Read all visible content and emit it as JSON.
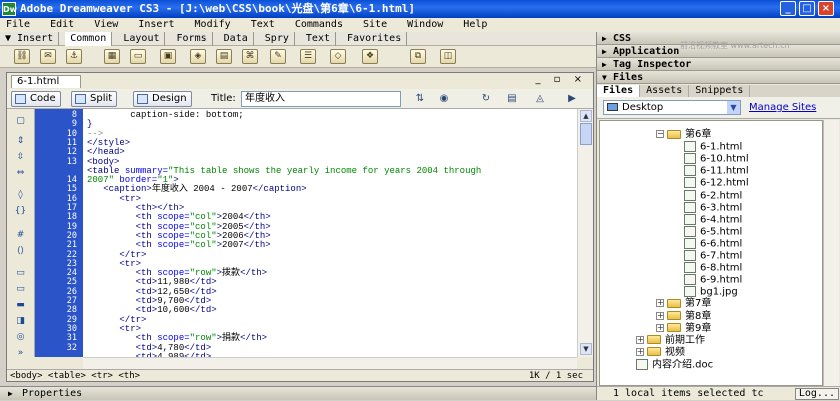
{
  "window": {
    "app_icon": "Dw",
    "title": "Adobe Dreamweaver CS3 - [J:\\web\\CSS\\book\\光盘\\第6章\\6-1.html]",
    "buttons": [
      "_",
      "□",
      "×"
    ]
  },
  "menu": [
    "File",
    "Edit",
    "View",
    "Insert",
    "Modify",
    "Text",
    "Commands",
    "Site",
    "Window",
    "Help"
  ],
  "insert_bar": {
    "label": "▼ Insert",
    "tabs": [
      "Common",
      "Layout",
      "Forms",
      "Data",
      "Spry",
      "Text",
      "Favorites"
    ],
    "active_tab": "Common"
  },
  "right_panel": {
    "watermark": "前沿视频教室 www.artech.cn",
    "panels": [
      "CSS",
      "Application",
      "Tag Inspector",
      "Files"
    ],
    "files_tabs": [
      "Files",
      "Assets",
      "Snippets"
    ],
    "site_select": "Desktop",
    "manage_sites": "Manage Sites",
    "tree": [
      {
        "label": "第6章",
        "type": "folder",
        "level": 0,
        "toggle": "−"
      },
      {
        "label": "6-1.html",
        "type": "file",
        "level": 1
      },
      {
        "label": "6-10.html",
        "type": "file",
        "level": 1
      },
      {
        "label": "6-11.html",
        "type": "file",
        "level": 1
      },
      {
        "label": "6-12.html",
        "type": "file",
        "level": 1
      },
      {
        "label": "6-2.html",
        "type": "file",
        "level": 1
      },
      {
        "label": "6-3.html",
        "type": "file",
        "level": 1
      },
      {
        "label": "6-4.html",
        "type": "file",
        "level": 1
      },
      {
        "label": "6-5.html",
        "type": "file",
        "level": 1
      },
      {
        "label": "6-6.html",
        "type": "file",
        "level": 1
      },
      {
        "label": "6-7.html",
        "type": "file",
        "level": 1
      },
      {
        "label": "6-8.html",
        "type": "file",
        "level": 1
      },
      {
        "label": "6-9.html",
        "type": "file",
        "level": 1
      },
      {
        "label": "bg1.jpg",
        "type": "file",
        "level": 1
      },
      {
        "label": "第7章",
        "type": "folder",
        "level": 0,
        "toggle": "+"
      },
      {
        "label": "第8章",
        "type": "folder",
        "level": 0,
        "toggle": "+"
      },
      {
        "label": "第9章",
        "type": "folder",
        "level": 0,
        "toggle": "+"
      },
      {
        "label": "前期工作",
        "type": "folder",
        "level": -1,
        "toggle": "+"
      },
      {
        "label": "视频",
        "type": "folder",
        "level": -1,
        "toggle": "+"
      },
      {
        "label": "内容介绍.doc",
        "type": "file",
        "level": -1
      }
    ],
    "status": "1 local items selected tc",
    "log_button": "Log..."
  },
  "document": {
    "tab": "6-1.html",
    "window_controls": "_ ▫ ×",
    "view_buttons": [
      "Code",
      "Split",
      "Design"
    ],
    "title_label": "Title:",
    "title_value": "年度收入",
    "line_numbers": [
      "8",
      "9",
      "10",
      "11",
      "12",
      "13",
      "",
      "14",
      "15",
      "16",
      "17",
      "18",
      "19",
      "20",
      "21",
      "22",
      "23",
      "24",
      "25",
      "26",
      "27",
      "28",
      "29",
      "30",
      "31",
      "32"
    ],
    "tag_selector": "<body> <table> <tr> <th>",
    "size": "1K / 1 sec"
  },
  "code_lines": [
    [
      [
        "tx",
        "        caption-side: bottom;"
      ]
    ],
    [
      [
        "tg",
        "}"
      ]
    ],
    [
      [
        "cm",
        "-->"
      ]
    ],
    [
      [
        "tg",
        "</style>"
      ]
    ],
    [
      [
        "tg",
        "</head>"
      ]
    ],
    [
      [
        "tg",
        "<body>"
      ]
    ],
    [
      [
        "tg",
        "<table "
      ],
      [
        "at",
        "summary="
      ],
      [
        "vl",
        "\"This table shows the yearly income for years 2004 through"
      ]
    ],
    [
      [
        "vl",
        "2007\" "
      ],
      [
        "at",
        "border="
      ],
      [
        "vl",
        "\"1\""
      ],
      [
        "tg",
        ">"
      ]
    ],
    [
      [
        "tg",
        "   <caption>"
      ],
      [
        "tx",
        "年度收入 2004 - 2007"
      ],
      [
        "tg",
        "</caption>"
      ]
    ],
    [
      [
        "tg",
        "      <tr>"
      ]
    ],
    [
      [
        "tg",
        "         <th></th>"
      ]
    ],
    [
      [
        "tg",
        "         <th "
      ],
      [
        "at",
        "scope="
      ],
      [
        "vl",
        "\"col\""
      ],
      [
        "tg",
        ">"
      ],
      [
        "tx",
        "2004"
      ],
      [
        "tg",
        "</th>"
      ]
    ],
    [
      [
        "tg",
        "         <th "
      ],
      [
        "at",
        "scope="
      ],
      [
        "vl",
        "\"col\""
      ],
      [
        "tg",
        ">"
      ],
      [
        "tx",
        "2005"
      ],
      [
        "tg",
        "</th>"
      ]
    ],
    [
      [
        "tg",
        "         <th "
      ],
      [
        "at",
        "scope="
      ],
      [
        "vl",
        "\"col\""
      ],
      [
        "tg",
        ">"
      ],
      [
        "tx",
        "2006"
      ],
      [
        "tg",
        "</th>"
      ]
    ],
    [
      [
        "tg",
        "         <th "
      ],
      [
        "at",
        "scope="
      ],
      [
        "vl",
        "\"col\""
      ],
      [
        "tg",
        ">"
      ],
      [
        "tx",
        "2007"
      ],
      [
        "tg",
        "</th>"
      ]
    ],
    [
      [
        "tg",
        "      </tr>"
      ]
    ],
    [
      [
        "tg",
        "      <tr>"
      ]
    ],
    [
      [
        "tg",
        "         <th "
      ],
      [
        "at",
        "scope="
      ],
      [
        "vl",
        "\"row\""
      ],
      [
        "tg",
        ">"
      ],
      [
        "tx",
        "拨款"
      ],
      [
        "tg",
        "</th>"
      ]
    ],
    [
      [
        "tg",
        "         <td>"
      ],
      [
        "tx",
        "11,980"
      ],
      [
        "tg",
        "</td>"
      ]
    ],
    [
      [
        "tg",
        "         <td>"
      ],
      [
        "tx",
        "12,650"
      ],
      [
        "tg",
        "</td>"
      ]
    ],
    [
      [
        "tg",
        "         <td>"
      ],
      [
        "tx",
        "9,700"
      ],
      [
        "tg",
        "</td>"
      ]
    ],
    [
      [
        "tg",
        "         <td>"
      ],
      [
        "tx",
        "10,600"
      ],
      [
        "tg",
        "</td>"
      ]
    ],
    [
      [
        "tg",
        "      </tr>"
      ]
    ],
    [
      [
        "tg",
        "      <tr>"
      ]
    ],
    [
      [
        "tg",
        "         <th "
      ],
      [
        "at",
        "scope="
      ],
      [
        "vl",
        "\"row\""
      ],
      [
        "tg",
        ">"
      ],
      [
        "tx",
        "捐款"
      ],
      [
        "tg",
        "</th>"
      ]
    ],
    [
      [
        "tg",
        "         <td>"
      ],
      [
        "tx",
        "4,780"
      ],
      [
        "tg",
        "</td>"
      ]
    ],
    [
      [
        "tg",
        "         <td>"
      ],
      [
        "tx",
        "4,989"
      ],
      [
        "tg",
        "</td>"
      ]
    ]
  ],
  "properties_panel": "Properties"
}
